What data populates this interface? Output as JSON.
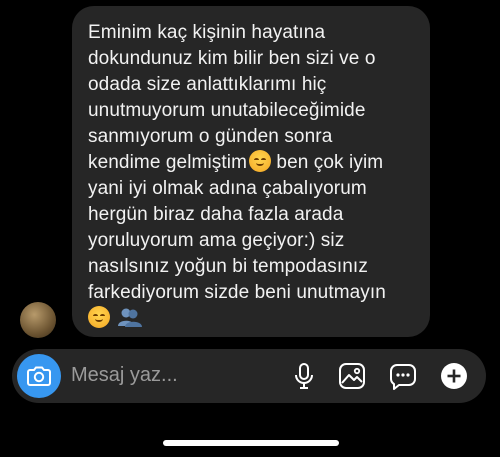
{
  "message": {
    "lines": [
      "Eminim kaç kişinin hayatına",
      "dokundunuz kim bilir ben sizi ve o",
      "odada size anlattıklarımı hiç",
      "unutmuyorum unutabileceğimide",
      "sanmıyorum o günden sonra",
      "kendime gelmiştim",
      " ben çok iyim",
      "yani iyi olmak adına çabalıyorum",
      "hergün biraz daha fazla arada",
      "yoruluyorum ama geçiyor:) siz",
      "nasılsınız yoğun bi tempodasınız",
      "farkediyorum sizde beni unutmayın"
    ],
    "emojis": [
      "smiling-face-emoji",
      "busts-in-silhouette-emoji"
    ]
  },
  "composer": {
    "placeholder": "Mesaj yaz...",
    "icons": [
      "camera-icon",
      "microphone-icon",
      "image-icon",
      "sticker-icon",
      "plus-icon"
    ]
  },
  "colors": {
    "background": "#000000",
    "bubble": "#262626",
    "accent": "#3797f0",
    "text": "#f2f2f2",
    "placeholder": "#9a9a9a"
  }
}
